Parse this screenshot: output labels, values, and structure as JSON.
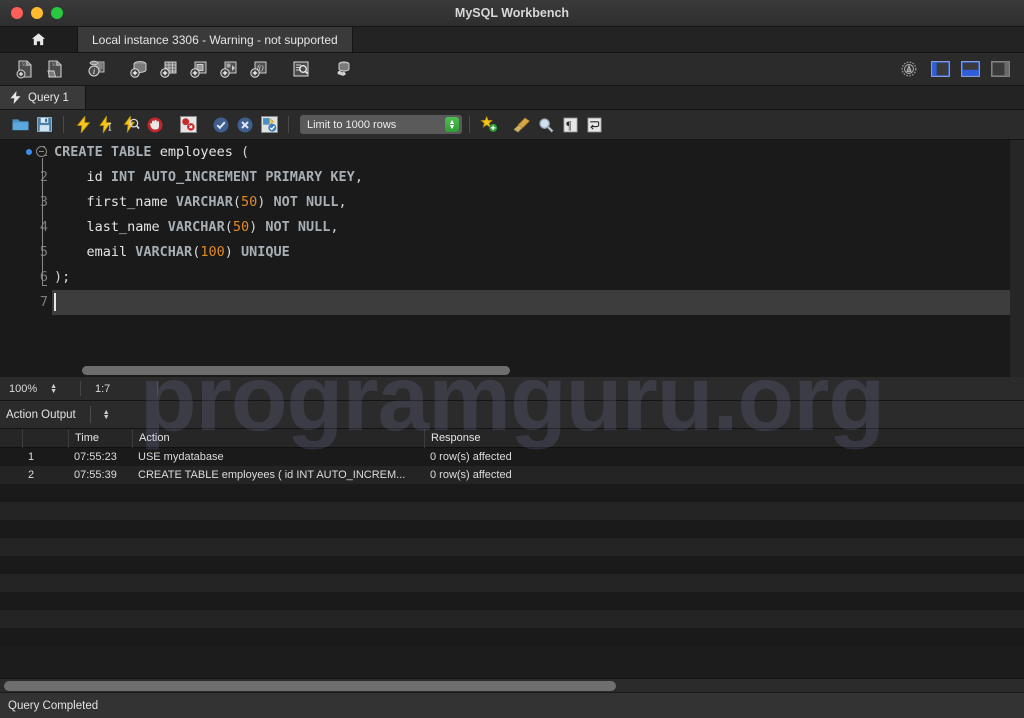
{
  "window": {
    "title": "MySQL Workbench",
    "traffic_lights": [
      "close",
      "minimize",
      "maximize"
    ]
  },
  "instance_bar": {
    "home_icon": "home-icon",
    "tab_label": "Local instance 3306 - Warning - not supported"
  },
  "main_toolbar": {
    "left_icons": [
      {
        "name": "new-sql-file-icon",
        "title": "Create a new SQL tab"
      },
      {
        "name": "open-sql-file-icon",
        "title": "Open a SQL script file"
      },
      {
        "name": "sql-info-icon",
        "title": "Open Inspector"
      },
      {
        "name": "new-schema-icon",
        "title": "Create new schema"
      },
      {
        "name": "new-table-icon",
        "title": "Create new table"
      },
      {
        "name": "new-view-icon",
        "title": "Create new view"
      },
      {
        "name": "new-procedure-icon",
        "title": "Create new stored procedure"
      },
      {
        "name": "new-function-icon",
        "title": "Create new function"
      },
      {
        "name": "search-data-icon",
        "title": "Search table data"
      },
      {
        "name": "reconnect-dbms-icon",
        "title": "Reconnect to DBMS"
      }
    ],
    "right_icons": [
      {
        "name": "settings-gear-icon",
        "title": "Settings"
      },
      {
        "name": "toggle-sidebar-icon",
        "title": "Show/Hide sidebar",
        "active": true
      },
      {
        "name": "toggle-output-icon",
        "title": "Show/Hide output",
        "active": true
      },
      {
        "name": "toggle-secondary-sidebar-icon",
        "title": "Show/Hide secondary sidebar",
        "active": false
      }
    ]
  },
  "query_tab": {
    "icon": "lightning-icon",
    "label": "Query 1"
  },
  "query_toolbar": {
    "icons": [
      {
        "name": "open-script-icon",
        "title": "Open a script file"
      },
      {
        "name": "save-script-icon",
        "title": "Save script to file"
      },
      {
        "name": "execute-icon",
        "title": "Execute the selected portion or everything"
      },
      {
        "name": "execute-current-icon",
        "title": "Execute current statement"
      },
      {
        "name": "explain-icon",
        "title": "Execute explain for current statement"
      },
      {
        "name": "stop-icon",
        "title": "Stop the query being executed"
      },
      {
        "name": "toggle-breakpoint-icon",
        "title": "Toggle whether execution stops on errors"
      },
      {
        "name": "commit-icon",
        "title": "Commit current transaction"
      },
      {
        "name": "rollback-icon",
        "title": "Rollback current transaction"
      },
      {
        "name": "autocommit-icon",
        "title": "Toggle auto-commit mode"
      },
      {
        "name": "beautify-icon",
        "title": "Beautify/reformat the SQL script"
      },
      {
        "name": "find-icon",
        "title": "Find"
      },
      {
        "name": "toggle-invisible-chars-icon",
        "title": "Show invisible characters"
      },
      {
        "name": "wrap-lines-icon",
        "title": "Wrap long lines"
      }
    ],
    "limit_label": "Limit to 1000 rows"
  },
  "editor": {
    "lines": [
      {
        "num": "1",
        "tokens": [
          {
            "t": "CREATE",
            "c": "kw"
          },
          {
            "t": " ",
            "c": "punct"
          },
          {
            "t": "TABLE",
            "c": "kw"
          },
          {
            "t": " ",
            "c": "punct"
          },
          {
            "t": "employees",
            "c": "ident"
          },
          {
            "t": " (",
            "c": "punct"
          }
        ],
        "marker": true,
        "fold": true
      },
      {
        "num": "2",
        "tokens": [
          {
            "t": "    id ",
            "c": "ident"
          },
          {
            "t": "INT",
            "c": "kw"
          },
          {
            "t": " ",
            "c": "punct"
          },
          {
            "t": "AUTO_INCREMENT",
            "c": "kw"
          },
          {
            "t": " ",
            "c": "punct"
          },
          {
            "t": "PRIMARY",
            "c": "kw"
          },
          {
            "t": " ",
            "c": "punct"
          },
          {
            "t": "KEY",
            "c": "kw"
          },
          {
            "t": ",",
            "c": "punct"
          }
        ]
      },
      {
        "num": "3",
        "tokens": [
          {
            "t": "    first_name ",
            "c": "ident"
          },
          {
            "t": "VARCHAR",
            "c": "kw"
          },
          {
            "t": "(",
            "c": "punct"
          },
          {
            "t": "50",
            "c": "num"
          },
          {
            "t": ") ",
            "c": "punct"
          },
          {
            "t": "NOT",
            "c": "kw"
          },
          {
            "t": " ",
            "c": "punct"
          },
          {
            "t": "NULL",
            "c": "kw"
          },
          {
            "t": ",",
            "c": "punct"
          }
        ]
      },
      {
        "num": "4",
        "tokens": [
          {
            "t": "    last_name ",
            "c": "ident"
          },
          {
            "t": "VARCHAR",
            "c": "kw"
          },
          {
            "t": "(",
            "c": "punct"
          },
          {
            "t": "50",
            "c": "num"
          },
          {
            "t": ") ",
            "c": "punct"
          },
          {
            "t": "NOT",
            "c": "kw"
          },
          {
            "t": " ",
            "c": "punct"
          },
          {
            "t": "NULL",
            "c": "kw"
          },
          {
            "t": ",",
            "c": "punct"
          }
        ]
      },
      {
        "num": "5",
        "tokens": [
          {
            "t": "    email ",
            "c": "ident"
          },
          {
            "t": "VARCHAR",
            "c": "kw"
          },
          {
            "t": "(",
            "c": "punct"
          },
          {
            "t": "100",
            "c": "num"
          },
          {
            "t": ") ",
            "c": "punct"
          },
          {
            "t": "UNIQUE",
            "c": "kw"
          }
        ]
      },
      {
        "num": "6",
        "tokens": [
          {
            "t": ");",
            "c": "punct"
          }
        ]
      },
      {
        "num": "7",
        "tokens": [],
        "caret": true
      }
    ]
  },
  "editor_status": {
    "zoom": "100%",
    "cursor_position": "1:7"
  },
  "output": {
    "selector_label": "Action Output",
    "columns": [
      "",
      "",
      "Time",
      "Action",
      "Response"
    ],
    "rows": [
      {
        "status": "success",
        "num": "1",
        "time": "07:55:23",
        "action": "USE mydatabase",
        "action_detail": "",
        "response": "0 row(s) affected"
      },
      {
        "status": "success",
        "num": "2",
        "time": "07:55:39",
        "action": "CREATE TABLE employees (",
        "action_detail": "id INT AUTO_INCREM...",
        "response": "0 row(s) affected"
      }
    ],
    "empty_row_count": 9
  },
  "statusbar": {
    "message": "Query Completed"
  },
  "watermark": {
    "text": "programguru.org"
  },
  "colors": {
    "accent_blue": "#3b6ee0",
    "keyword": "#a8afb4",
    "number": "#e08a28",
    "identifier": "#e4e4e4",
    "success_green": "#29a335",
    "window_bg": "#1c1c1c"
  }
}
